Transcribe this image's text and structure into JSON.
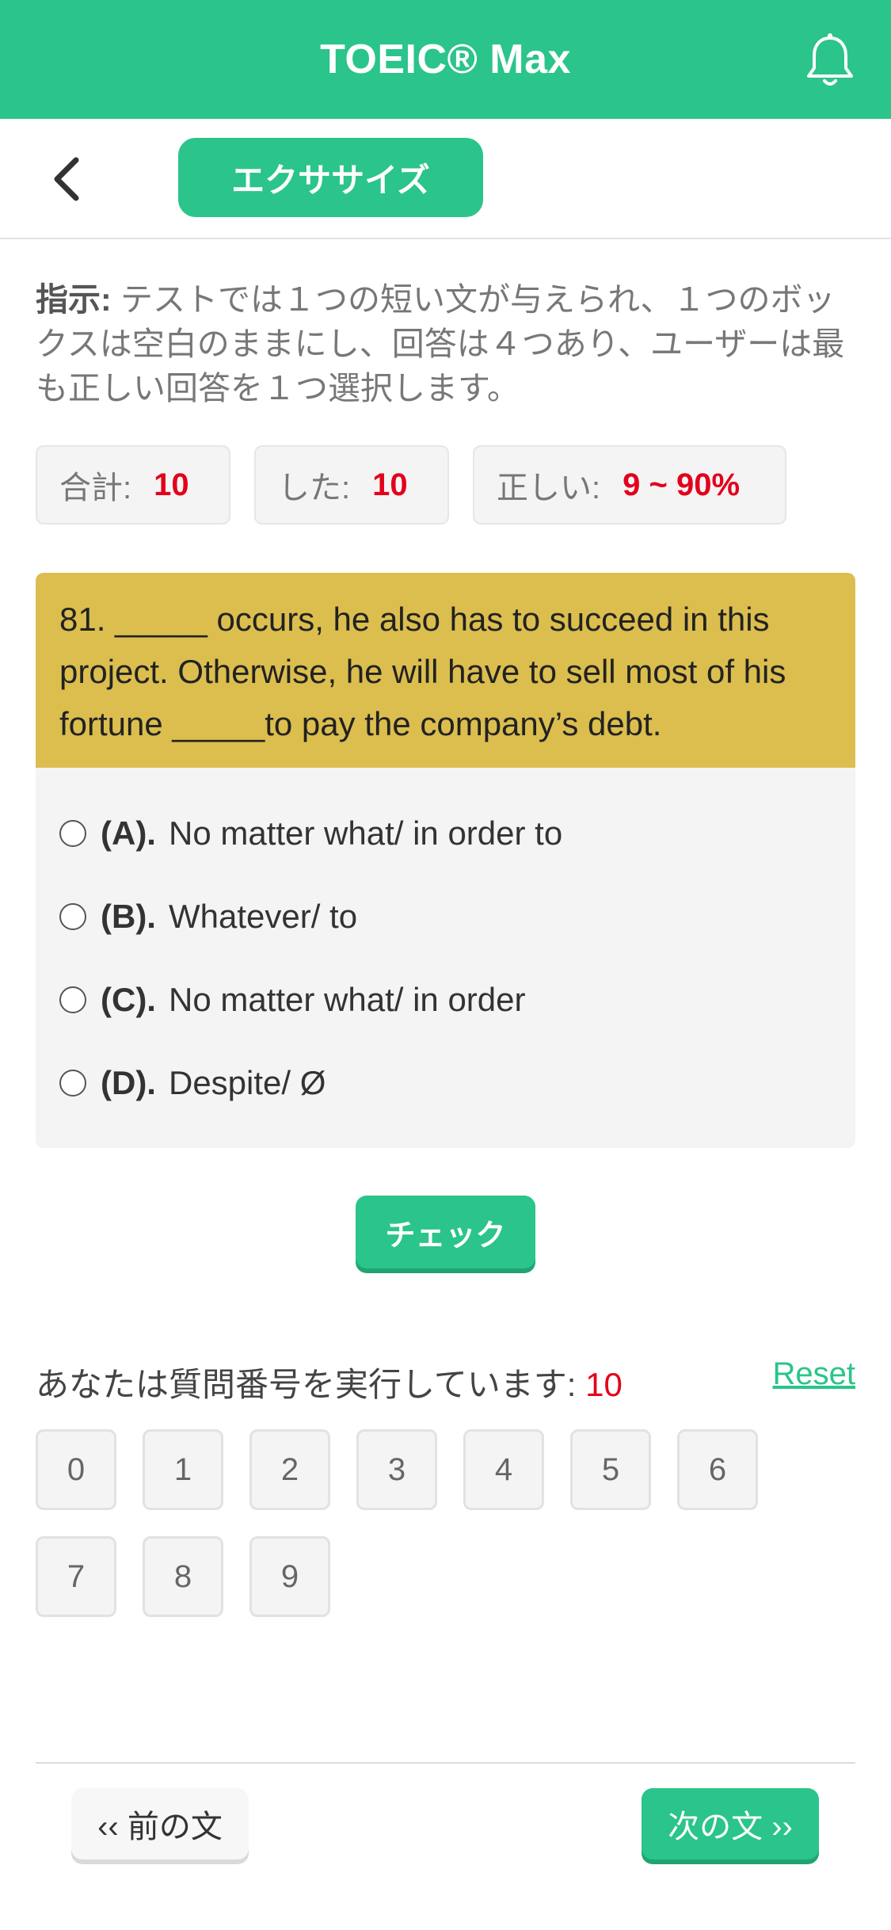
{
  "app": {
    "title": "TOEIC® Max"
  },
  "header": {
    "exercise_label": "エクササイズ"
  },
  "instructions": {
    "label": "指示:",
    "text": " テストでは１つの短い文が与えられ、１つのボックスは空白のままにし、回答は４つあり、ユーザーは最も正しい回答を１つ選択します。"
  },
  "stats": {
    "total_label": "合計:",
    "total_value": "10",
    "done_label": "した:",
    "done_value": "10",
    "correct_label": "正しい:",
    "correct_value": "9 ~ 90%"
  },
  "question": {
    "text": "81. _____ occurs, he also has to succeed in this project. Otherwise, he will have to sell most of his fortune _____to pay the company’s debt."
  },
  "options": [
    {
      "letter": "(A).",
      "text": "No matter what/ in order to"
    },
    {
      "letter": "(B).",
      "text": "Whatever/ to"
    },
    {
      "letter": "(C).",
      "text": "No matter what/ in order"
    },
    {
      "letter": "(D).",
      "text": "Despite/ Ø"
    }
  ],
  "check_label": "チェック",
  "progress": {
    "label": "あなたは質問番号を実行しています:",
    "current": "10",
    "reset_label": "Reset",
    "numbers": [
      "0",
      "1",
      "2",
      "3",
      "4",
      "5",
      "6",
      "7",
      "8",
      "9"
    ]
  },
  "nav": {
    "prev_label": "‹‹ 前の文",
    "next_label": "次の文 ››"
  },
  "colors": {
    "primary": "#2bc48a",
    "question_bg": "#dbbe4e",
    "highlight": "#e3001b"
  },
  "icons": {
    "bell": "bell-icon",
    "back": "back-chevron-icon"
  }
}
